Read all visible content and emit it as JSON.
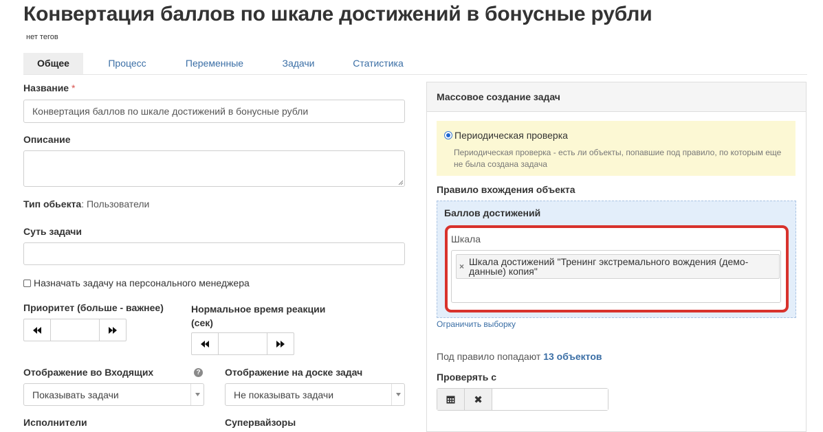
{
  "header": {
    "title": "Конвертация баллов по шкале достижений в бонусные рубли",
    "tags": "нет тегов"
  },
  "tabs": [
    {
      "label": "Общее",
      "active": true
    },
    {
      "label": "Процесс",
      "active": false
    },
    {
      "label": "Переменные",
      "active": false
    },
    {
      "label": "Задачи",
      "active": false
    },
    {
      "label": "Статистика",
      "active": false
    }
  ],
  "form": {
    "name_label": "Название",
    "required_mark": "*",
    "name_value": "Конвертация баллов по шкале достижений в бонусные рубли",
    "description_label": "Описание",
    "object_type_label": "Тип обьекта",
    "object_type_value": ": Пользователи",
    "essence_label": "Суть задачи",
    "assign_manager_label": "Назначать задачу на персонального менеджера",
    "priority_label": "Приоритет (больше - важнее)",
    "reaction_time_label_1": "Нормальное время реакции",
    "reaction_time_label_2": "(сек)",
    "inbox_display_label": "Отображение во Входящих",
    "help_glyph": "?",
    "inbox_display_value": "Показывать задачи",
    "board_display_label": "Отображение на доске задач",
    "board_display_value": "Не показывать задачи",
    "executors_label": "Исполнители",
    "supervisors_label": "Супервайзоры"
  },
  "panel": {
    "title": "Массовое создание задач",
    "periodic_check_label": "Периодическая проверка",
    "periodic_check_desc_1": "Периодическая проверка - есть ли объекты, попавшие под правило, по которым еще",
    "periodic_check_desc_2": "не была создана задача",
    "rule_label": "Правило вхождения объекта",
    "condition_title": "Баллов достижений",
    "scale_label": "Шкала",
    "scale_chip_1": "Шкала достижений \"Тренинг экстремального вождения (демо-",
    "scale_chip_2": "данные) копия\"",
    "chip_remove": "×",
    "limit_link": "Ограничить выборку",
    "objects_prefix": "Под правило попадают",
    "objects_count": "13 объектов",
    "check_from_label": "Проверять с",
    "clear_glyph": "✖"
  },
  "colors": {
    "accent_link": "#3a6ea5",
    "highlight_border": "#d8322c",
    "notice_bg": "#fcf8d4",
    "condition_bg": "#e3eefa"
  },
  "icons": {
    "stepper_down": "double-left-icon",
    "stepper_up": "double-right-icon",
    "calendar": "calendar-icon",
    "clear": "close-icon"
  }
}
